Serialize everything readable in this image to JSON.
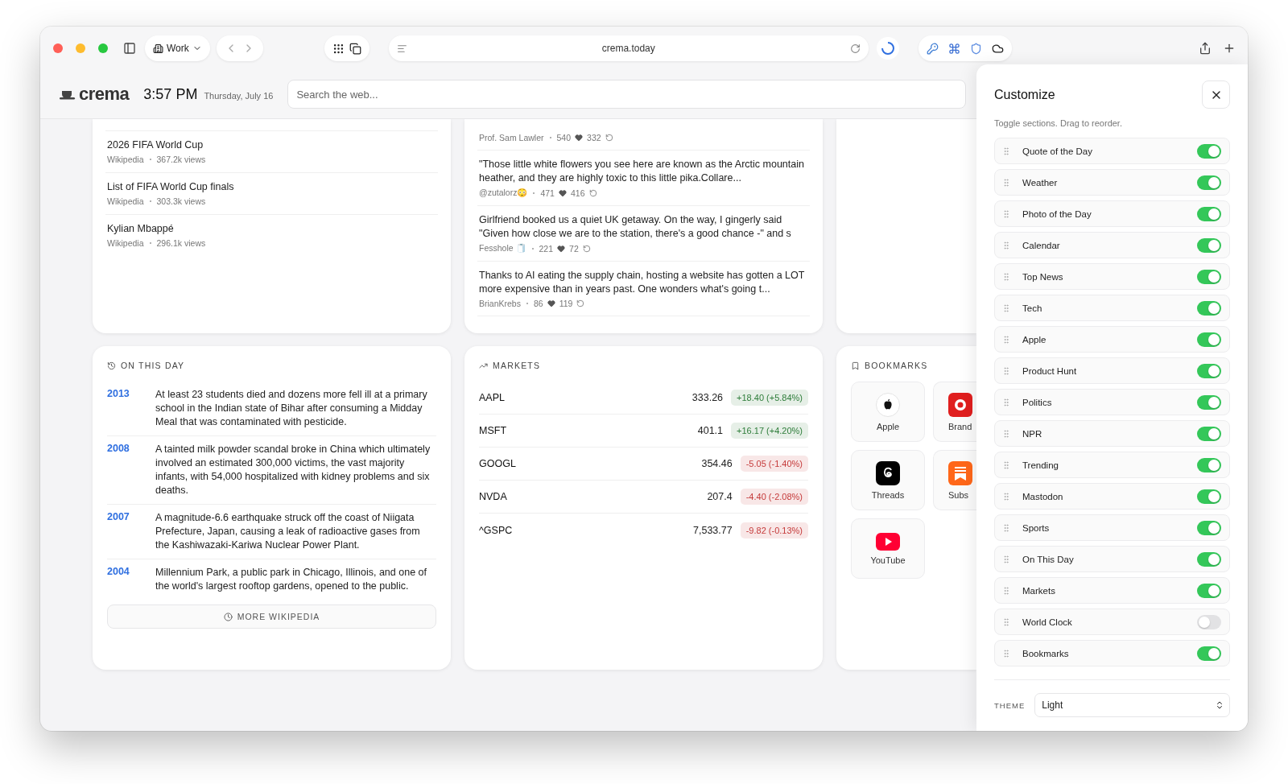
{
  "browser": {
    "profile": "Work",
    "url": "crema.today"
  },
  "header": {
    "logo": "crema",
    "time": "3:57 PM",
    "date": "Thursday, July 16",
    "search": {
      "placeholder": "Search the web..."
    }
  },
  "trending": {
    "items": [
      {
        "title": "2026 FIFA World Cup",
        "source": "Wikipedia",
        "views": "367.2k views"
      },
      {
        "title": "List of FIFA World Cup finals",
        "source": "Wikipedia",
        "views": "303.3k views"
      },
      {
        "title": "Kylian Mbappé",
        "source": "Wikipedia",
        "views": "296.1k views"
      }
    ]
  },
  "posts": [
    {
      "author": "Prof. Sam Lawler",
      "likes": "540",
      "boosts": "332"
    },
    {
      "text": "\"Those little white flowers you see here are known as the Arctic mountain heather, and they are highly toxic to this little pika.Collare...",
      "author": "@zutalorz😳",
      "likes": "471",
      "boosts": "416"
    },
    {
      "text": "Girlfriend booked us a quiet UK getaway. On the way, I gingerly said \"Given how close we are to the station, there's a good chance -\" and s",
      "author": "Fesshole 🧻",
      "likes": "221",
      "boosts": "72"
    },
    {
      "text": "Thanks to AI eating the supply chain, hosting a website has gotten a LOT more expensive than in years past. One wonders what's going t...",
      "author": "BrianKrebs",
      "likes": "86",
      "boosts": "119"
    }
  ],
  "on_this_day": {
    "title": "ON THIS DAY",
    "events": [
      {
        "year": "2013",
        "text": "At least 23 students died and dozens more fell ill at a primary school in the Indian state of Bihar after consuming a Midday Meal that was contaminated with pesticide."
      },
      {
        "year": "2008",
        "text": "A tainted milk powder scandal broke in China which ultimately involved an estimated 300,000 victims, the vast majority infants, with 54,000 hospitalized with kidney problems and six deaths."
      },
      {
        "year": "2007",
        "text": "A magnitude-6.6 earthquake struck off the coast of Niigata Prefecture, Japan, causing a leak of radioactive gases from the Kashiwazaki-Kariwa Nuclear Power Plant."
      },
      {
        "year": "2004",
        "text": "Millennium Park, a public park in Chicago, Illinois, and one of the world's largest rooftop gardens, opened to the public."
      }
    ],
    "more_button": "MORE WIKIPEDIA"
  },
  "markets": {
    "title": "MARKETS",
    "rows": [
      {
        "symbol": "AAPL",
        "price": "333.26",
        "change": "+18.40 (+5.84%)",
        "color": "#2e7d3a"
      },
      {
        "symbol": "MSFT",
        "price": "401.1",
        "change": "+16.17 (+4.20%)",
        "color": "#2e7d3a"
      },
      {
        "symbol": "GOOGL",
        "price": "354.46",
        "change": "-5.05 (-1.40%)",
        "color": "#c53a3a"
      },
      {
        "symbol": "NVDA",
        "price": "207.4",
        "change": "-4.40 (-2.08%)",
        "color": "#c53a3a"
      },
      {
        "symbol": "^GSPC",
        "price": "7,533.77",
        "change": "-9.82 (-0.13%)",
        "color": "#c53a3a"
      }
    ]
  },
  "bookmarks": {
    "title": "BOOKMARKS",
    "items": [
      {
        "label": "Apple",
        "kind": "apple"
      },
      {
        "label": "Brand",
        "kind": "red"
      },
      {
        "label": "Threads",
        "kind": "threads"
      },
      {
        "label": "Subs",
        "kind": "orange"
      },
      {
        "label": "YouTube",
        "kind": "youtube"
      }
    ]
  },
  "customize": {
    "title": "Customize",
    "hint": "Toggle sections. Drag to reorder.",
    "sections": [
      {
        "label": "Quote of the Day",
        "on": true
      },
      {
        "label": "Weather",
        "on": true
      },
      {
        "label": "Photo of the Day",
        "on": true
      },
      {
        "label": "Calendar",
        "on": true
      },
      {
        "label": "Top News",
        "on": true
      },
      {
        "label": "Tech",
        "on": true
      },
      {
        "label": "Apple",
        "on": true
      },
      {
        "label": "Product Hunt",
        "on": true
      },
      {
        "label": "Politics",
        "on": true
      },
      {
        "label": "NPR",
        "on": true
      },
      {
        "label": "Trending",
        "on": true
      },
      {
        "label": "Mastodon",
        "on": true
      },
      {
        "label": "Sports",
        "on": true
      },
      {
        "label": "On This Day",
        "on": true
      },
      {
        "label": "Markets",
        "on": true
      },
      {
        "label": "World Clock",
        "on": false
      },
      {
        "label": "Bookmarks",
        "on": true
      }
    ],
    "theme_label": "THEME",
    "theme_value": "Light"
  }
}
